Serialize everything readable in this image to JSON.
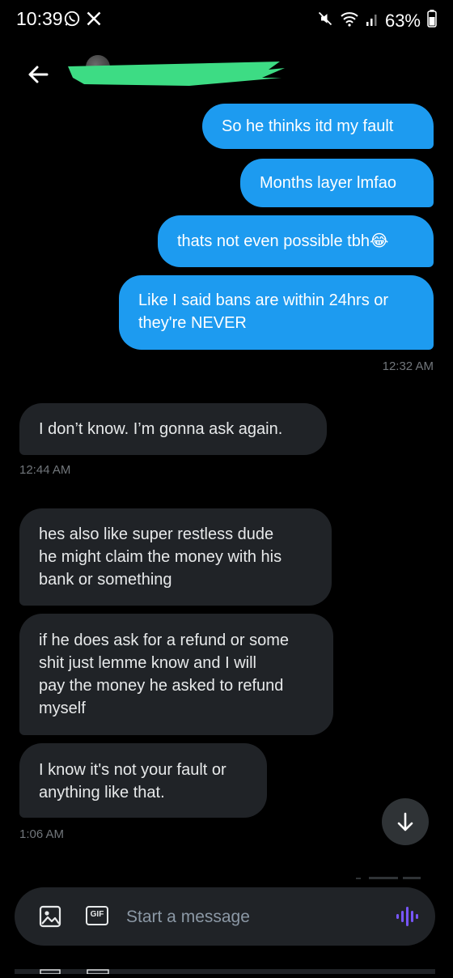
{
  "status_bar": {
    "time": "10:39",
    "battery": "63%",
    "icons": [
      "whatsapp-icon",
      "x-icon",
      "mute-icon",
      "wifi-icon",
      "signal-icon",
      "battery-icon"
    ]
  },
  "messages": [
    {
      "type": "sent",
      "text": "So he thinks itd my fault"
    },
    {
      "type": "sent",
      "text": "Months layer lmfao"
    },
    {
      "type": "sent",
      "text": "thats not even possible tbh😂"
    },
    {
      "type": "sent",
      "lines": [
        "Like I said bans are within 24hrs or",
        "they're NEVER"
      ]
    },
    {
      "type": "received",
      "text": "I don’t know. I’m gonna ask again."
    },
    {
      "type": "received",
      "lines": [
        "hes also like super restless dude",
        "he might claim the money with his",
        "bank or something"
      ]
    },
    {
      "type": "received",
      "lines": [
        "if he does ask for a refund or some",
        "shit just lemme know and I will",
        "pay the money he asked to refund",
        "myself"
      ]
    },
    {
      "type": "received",
      "lines": [
        "I know it's not your fault or",
        "anything like that."
      ]
    }
  ],
  "timestamps": [
    "12:32 AM",
    "12:44 AM",
    "1:06 AM"
  ],
  "composer": {
    "placeholder": "Start a message",
    "gif_label": "GIF"
  },
  "colors": {
    "background": "#000000",
    "sent_bubble": "#1d9bf0",
    "received_bubble": "#202327",
    "timestamp": "#71767b",
    "voice_accent": "#7856ff",
    "redaction": "#3ddc84"
  }
}
